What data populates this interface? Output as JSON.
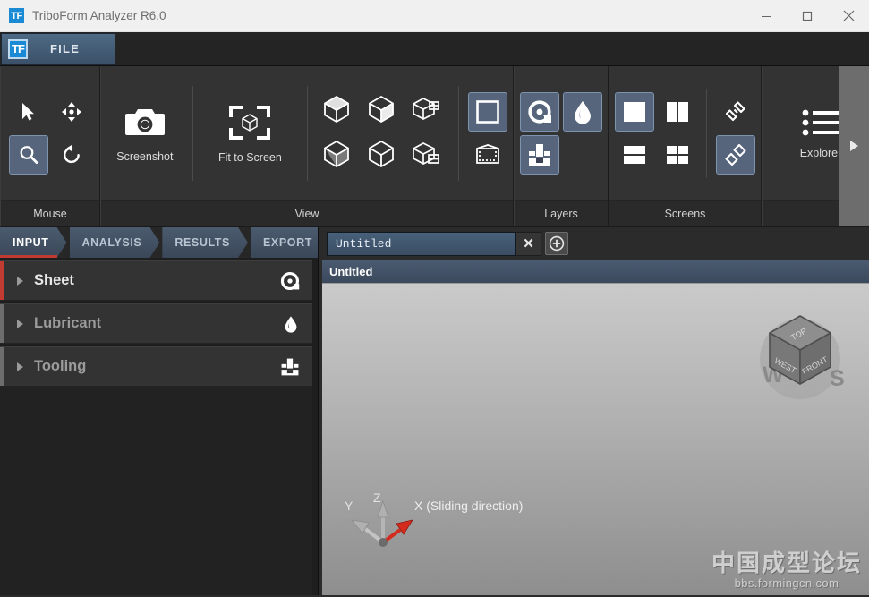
{
  "window": {
    "title": "TriboForm Analyzer R6.0",
    "logo_text": "TF",
    "minimize_icon": "minimize-icon",
    "maximize_icon": "maximize-icon",
    "close_icon": "close-icon"
  },
  "filebar": {
    "logo_text": "TF",
    "file_label": "FILE"
  },
  "ribbon": {
    "groups": [
      {
        "title": "Mouse",
        "items": [
          {
            "icon": "cursor-arrow-icon",
            "selected": false
          },
          {
            "icon": "pan-move-icon",
            "selected": false
          },
          {
            "icon": "zoom-magnifier-icon",
            "selected": true
          },
          {
            "icon": "rotate-icon",
            "selected": false
          }
        ]
      },
      {
        "title": "View",
        "screenshot_label": "Screenshot",
        "screenshot_icon": "camera-icon",
        "fit_label": "Fit to Screen",
        "fit_icon": "fit-to-screen-icon",
        "view_icons": [
          "cube-isometric-icon",
          "cube-top-icon",
          "cube-open-top-icon",
          "cube-bottom-icon",
          "cube-front-icon",
          "cube-open-front-icon"
        ],
        "extra_icons": [
          {
            "icon": "square-frame-icon",
            "selected": true
          },
          {
            "icon": "clipping-box-icon",
            "selected": false
          }
        ]
      },
      {
        "title": "Layers",
        "items": [
          {
            "icon": "sheet-coil-icon",
            "selected": true
          },
          {
            "icon": "lubricant-drop-icon",
            "selected": true
          },
          {
            "icon": "tooling-press-icon",
            "selected": true
          }
        ]
      },
      {
        "title": "Screens",
        "items": [
          {
            "icon": "single-pane-icon",
            "selected": true
          },
          {
            "icon": "two-column-pane-icon",
            "selected": false
          },
          {
            "icon": "two-row-pane-icon",
            "selected": false
          },
          {
            "icon": "four-pane-icon",
            "selected": false
          },
          {
            "icon": "link-views-icon",
            "selected": false
          },
          {
            "icon": "unlink-views-icon",
            "selected": true
          }
        ]
      },
      {
        "title": "",
        "explorer_label": "Explorer",
        "explorer_icon": "bulleted-list-icon"
      }
    ],
    "expand_icon": "expand-right-arrow-icon"
  },
  "breadcrumbs": [
    {
      "label": "INPUT",
      "active": true
    },
    {
      "label": "ANALYSIS",
      "active": false
    },
    {
      "label": "RESULTS",
      "active": false
    },
    {
      "label": "EXPORT",
      "active": false
    }
  ],
  "sidebar": {
    "items": [
      {
        "label": "Sheet",
        "icon": "sheet-coil-icon",
        "highlighted": true
      },
      {
        "label": "Lubricant",
        "icon": "lubricant-drop-icon",
        "highlighted": false
      },
      {
        "label": "Tooling",
        "icon": "tooling-press-icon",
        "highlighted": false
      }
    ]
  },
  "document": {
    "tab_name": "Untitled",
    "close_label": "✕",
    "add_icon": "add-circle-icon",
    "viewport_title": "Untitled"
  },
  "viewport": {
    "viewcube": {
      "top_face": "TOP",
      "left_face": "WEST",
      "front_face": "FRONT",
      "compass_w": "W",
      "compass_s": "S"
    },
    "axes": {
      "x_label": "X (Sliding direction)",
      "y_label": "Y",
      "z_label": "Z",
      "x_color": "#d42b1e",
      "y_color": "#b7b7b7",
      "z_color": "#b7b7b7"
    },
    "watermark_cn": "中国成型论坛",
    "watermark_url": "bbs.formingcn.com"
  },
  "colors": {
    "accent_blue": "#1b8ad4",
    "selection": "#56657c",
    "active_red": "#c23b32"
  }
}
